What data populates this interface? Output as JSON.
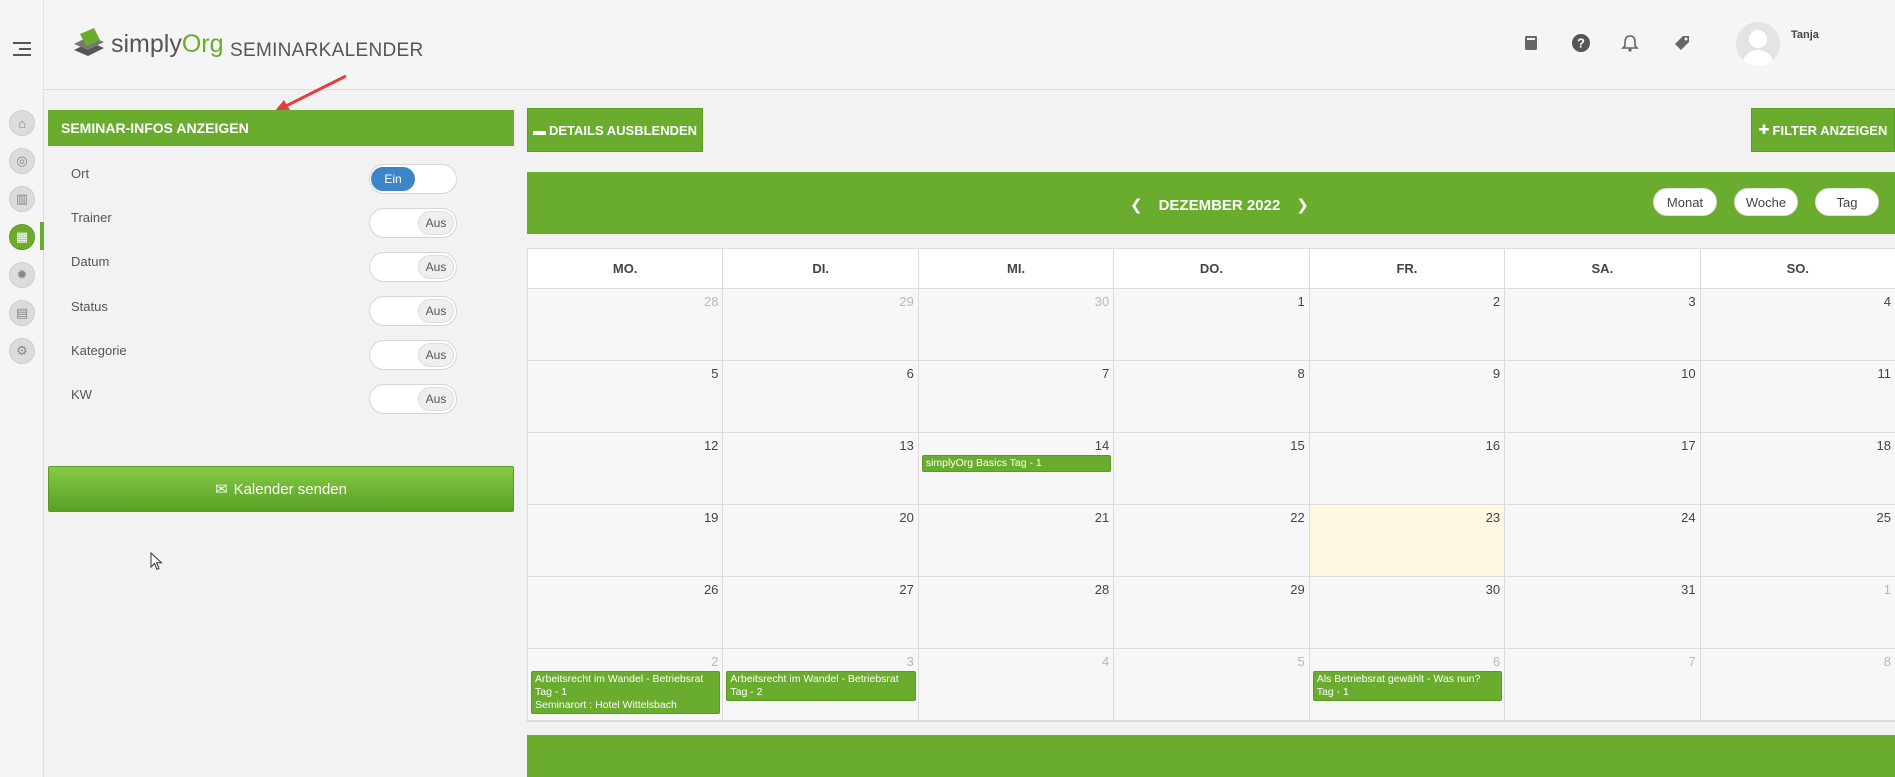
{
  "app": {
    "logo_text_1": "simply",
    "logo_text_2": "Org",
    "page_title": "SEMINARKALENDER",
    "user_name": "Tanja"
  },
  "header_icons": [
    "book-icon",
    "help-icon",
    "bell-icon",
    "tag-icon"
  ],
  "rail_icons": [
    "home-icon",
    "seminar-icon",
    "chart-icon",
    "calendar-icon",
    "settings-sun-icon",
    "document-icon",
    "gear-icon"
  ],
  "panel": {
    "title": "SEMINAR-INFOS ANZEIGEN",
    "options": [
      {
        "label": "Ort",
        "state": "Ein",
        "on": true
      },
      {
        "label": "Trainer",
        "state": "Aus",
        "on": false
      },
      {
        "label": "Datum",
        "state": "Aus",
        "on": false
      },
      {
        "label": "Status",
        "state": "Aus",
        "on": false
      },
      {
        "label": "Kategorie",
        "state": "Aus",
        "on": false
      },
      {
        "label": "KW",
        "state": "Aus",
        "on": false
      }
    ],
    "send_button": "Kalender senden"
  },
  "actions": {
    "hide_details": "DETAILS AUSBLENDEN",
    "show_filter": "FILTER ANZEIGEN"
  },
  "calendar": {
    "month_label": "DEZEMBER 2022",
    "views": [
      "Monat",
      "Woche",
      "Tag"
    ],
    "weekdays": [
      "MO.",
      "DI.",
      "MI.",
      "DO.",
      "FR.",
      "SA.",
      "SO."
    ],
    "weeks": [
      [
        {
          "d": "28",
          "o": true
        },
        {
          "d": "29",
          "o": true
        },
        {
          "d": "30",
          "o": true
        },
        {
          "d": "1"
        },
        {
          "d": "2"
        },
        {
          "d": "3"
        },
        {
          "d": "4"
        }
      ],
      [
        {
          "d": "5"
        },
        {
          "d": "6"
        },
        {
          "d": "7"
        },
        {
          "d": "8"
        },
        {
          "d": "9"
        },
        {
          "d": "10"
        },
        {
          "d": "11"
        }
      ],
      [
        {
          "d": "12"
        },
        {
          "d": "13"
        },
        {
          "d": "14"
        },
        {
          "d": "15"
        },
        {
          "d": "16"
        },
        {
          "d": "17"
        },
        {
          "d": "18"
        }
      ],
      [
        {
          "d": "19"
        },
        {
          "d": "20"
        },
        {
          "d": "21"
        },
        {
          "d": "22"
        },
        {
          "d": "23",
          "today": true
        },
        {
          "d": "24"
        },
        {
          "d": "25"
        }
      ],
      [
        {
          "d": "26"
        },
        {
          "d": "27"
        },
        {
          "d": "28"
        },
        {
          "d": "29"
        },
        {
          "d": "30"
        },
        {
          "d": "31"
        },
        {
          "d": "1",
          "o": true
        }
      ],
      [
        {
          "d": "2",
          "o": true
        },
        {
          "d": "3",
          "o": true
        },
        {
          "d": "4",
          "o": true
        },
        {
          "d": "5",
          "o": true
        },
        {
          "d": "6",
          "o": true
        },
        {
          "d": "7",
          "o": true
        },
        {
          "d": "8",
          "o": true
        }
      ]
    ],
    "events": [
      {
        "week": 2,
        "day": 2,
        "lines": [
          "simplyOrg Basics Tag - 1"
        ]
      },
      {
        "week": 5,
        "day": 0,
        "lines": [
          "Arbeitsrecht im Wandel - Betriebsrat",
          "Tag - 1",
          "Seminarort : Hotel Wittelsbach"
        ]
      },
      {
        "week": 5,
        "day": 1,
        "lines": [
          "Arbeitsrecht im Wandel - Betriebsrat",
          "Tag - 2"
        ]
      },
      {
        "week": 5,
        "day": 4,
        "lines": [
          "Als Betriebsrat gewählt - Was nun?",
          "Tag - 1"
        ]
      }
    ]
  },
  "colors": {
    "brand_green": "#6aac2e",
    "toggle_blue": "#3c86c8",
    "today_bg": "#fcf8e3"
  }
}
